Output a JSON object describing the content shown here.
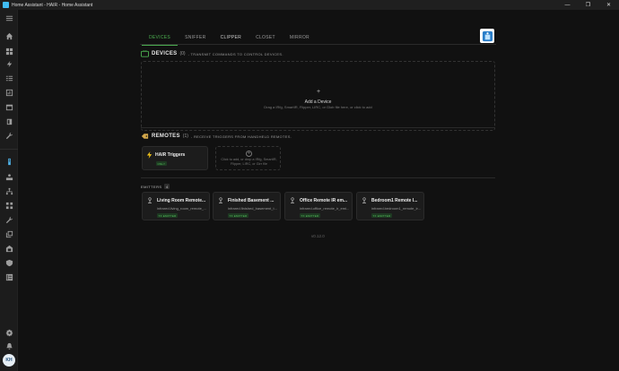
{
  "window": {
    "title": "Home Assistant - HAIR - Home Assistant",
    "controls": [
      "—",
      "❐",
      "✕"
    ]
  },
  "sidebar": {
    "items": [
      {
        "icon": "menu-icon"
      },
      {
        "icon": "home-icon"
      },
      {
        "icon": "grid-icon"
      },
      {
        "icon": "lightning-icon"
      },
      {
        "icon": "list-icon"
      },
      {
        "icon": "chart-icon"
      },
      {
        "icon": "calendar-icon"
      },
      {
        "icon": "box-icon"
      },
      {
        "icon": "wrench-icon"
      },
      {
        "icon": "remote-icon",
        "active": true
      },
      {
        "icon": "hub-icon"
      },
      {
        "icon": "network-icon"
      },
      {
        "icon": "grid-small-icon"
      },
      {
        "icon": "tool-icon"
      },
      {
        "icon": "copy-icon"
      },
      {
        "icon": "barn-icon"
      },
      {
        "icon": "shield-icon"
      },
      {
        "icon": "list-view-icon"
      },
      {
        "icon": "gear-icon"
      },
      {
        "icon": "bell-icon"
      }
    ],
    "avatar": "KH"
  },
  "tabs": [
    "DEVICES",
    "SNIFFER",
    "CLIPPER",
    "CLOSET",
    "MIRROR"
  ],
  "devices": {
    "heading": "DEVICES",
    "count": "(0)",
    "description": "- TRANSMIT COMMANDS TO CONTROL DEVICES.",
    "add_title": "Add a Device",
    "add_subtitle": "Drag a IRfg, SmartIR, Flipper, LIRC, or Glob file here, or click to add"
  },
  "remotes": {
    "heading": "REMOTES",
    "count": "(1)",
    "description": "- RECEIVE TRIGGERS FROM HANDHELD REMOTES.",
    "cards": [
      {
        "name": "HAIR Triggers",
        "badge": "ONLY"
      }
    ],
    "add_text": "Click to add, or drop a IRfg, SmartIR, Flipper, LIRC, or Girr file"
  },
  "emitters": {
    "heading": "EMITTERS",
    "count": "4",
    "items": [
      {
        "name": "Living Room Remote...",
        "id": "infrared.living_room_remote_...",
        "badge": "TX EMITTER"
      },
      {
        "name": "Finished Basement ...",
        "id": "infrared.finished_basement_t...",
        "badge": "TX EMITTER"
      },
      {
        "name": "Office Remote IR em...",
        "id": "infrared.office_remote_ir_emi...",
        "badge": "TX EMITTER"
      },
      {
        "name": "Bedroom1 Remote I...",
        "id": "infrared.bedroom1_remote_ir...",
        "badge": "TX EMITTER"
      }
    ]
  },
  "version": "v0.12.0",
  "colors": {
    "accent": "#4caf50",
    "active_icon": "#4fb3e8",
    "background": "#111111"
  }
}
